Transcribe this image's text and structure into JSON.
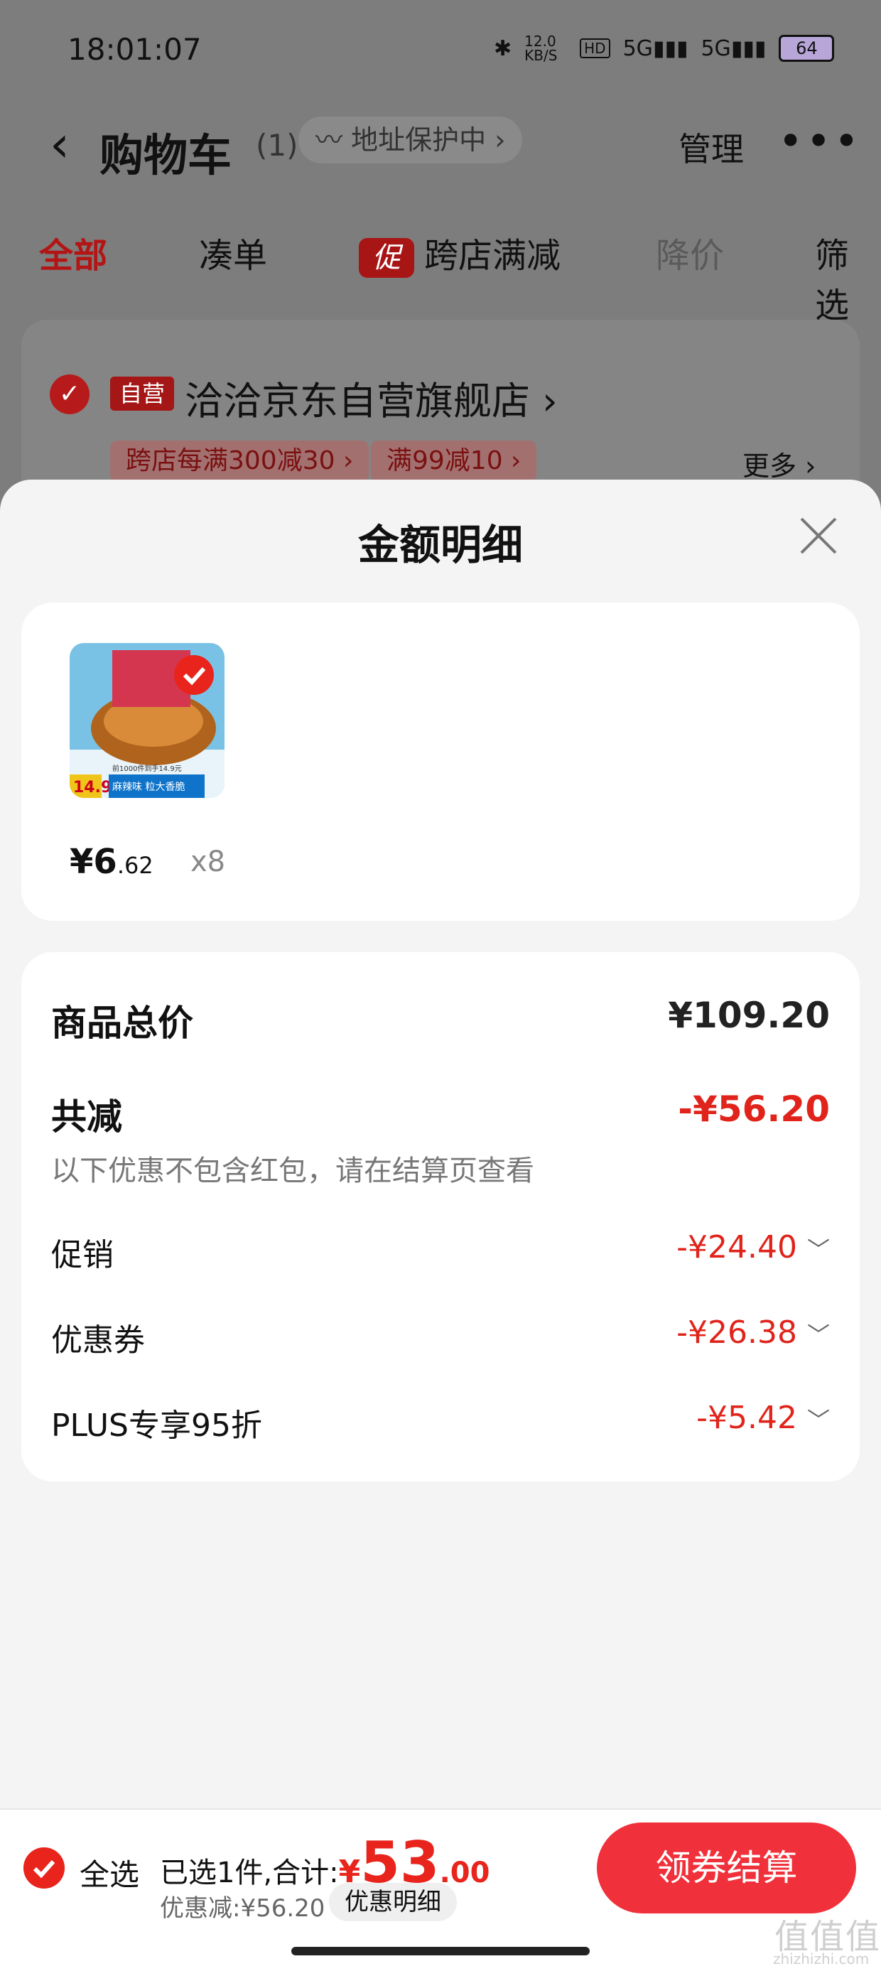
{
  "status_bar": {
    "time": "18:01:07",
    "network_speed": "12.0 KB/S",
    "hd_label": "HD",
    "signal_1": "5G",
    "signal_2": "5G",
    "battery": "64"
  },
  "header": {
    "title": "购物车",
    "count": "(1)",
    "address_chip": "地址保护中",
    "manage_label": "管理",
    "more_label": "•••"
  },
  "tabs": [
    {
      "label": "全部",
      "active": true
    },
    {
      "label": "凑单"
    },
    {
      "label": "跨店满减",
      "badge": "促"
    },
    {
      "label": "降价"
    },
    {
      "label": "筛选"
    }
  ],
  "store": {
    "self_tag": "自营",
    "name": "洽洽京东自营旗舰店",
    "promos": [
      "跨店每满300减30 ›",
      "满99减10 ›"
    ],
    "more": "更多 ›"
  },
  "sheet": {
    "title": "金额明细",
    "product": {
      "image_text_price": "14.9",
      "image_text_caption": "麻辣味 粒大香脆",
      "image_text_top": "前1000件到手14.9元",
      "price_symbol": "¥",
      "price_int": "6",
      "price_dec": ".62",
      "qty": "x8"
    },
    "summary": {
      "total_label": "商品总价",
      "total_value": "¥109.20",
      "reduce_label": "共减",
      "reduce_value": "-¥56.20",
      "note": "以下优惠不包含红包，请在结算页查看",
      "rows": [
        {
          "label": "促销",
          "value": "-¥24.40"
        },
        {
          "label": "优惠券",
          "value": "-¥26.38"
        },
        {
          "label": "PLUS专享95折",
          "value": "-¥5.42"
        }
      ]
    }
  },
  "bottom_bar": {
    "select_all": "全选",
    "selected_text": "已选1件,合计:",
    "currency": "¥",
    "total_int": "53",
    "total_dec": ".00",
    "discount_text": "优惠减:¥56.20",
    "detail_button": "优惠明细",
    "checkout_button": "领券结算"
  },
  "watermark": {
    "text": "值值值",
    "sub": "zhizhizhi.com"
  },
  "colors": {
    "accent_red": "#e8241c",
    "checkout_red": "#f0303a",
    "sheet_bg": "#f4f4f4"
  }
}
